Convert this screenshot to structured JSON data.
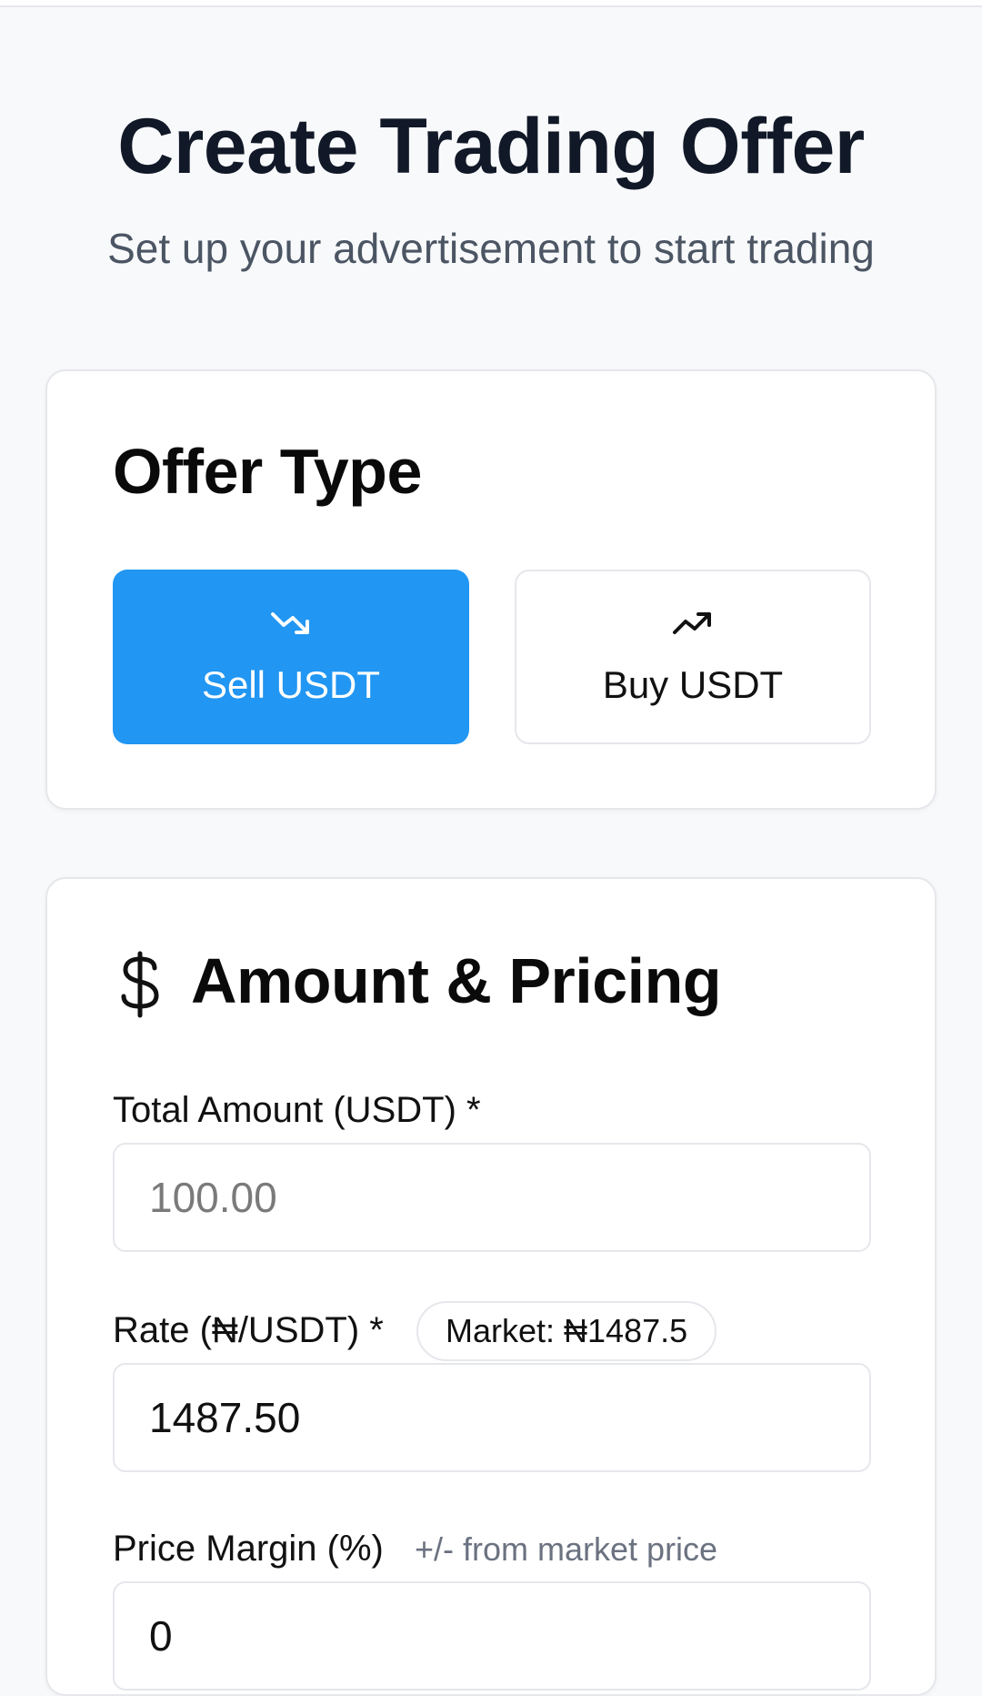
{
  "header": {
    "title": "Create Trading Offer",
    "subtitle": "Set up your advertisement to start trading"
  },
  "offer_type": {
    "title": "Offer Type",
    "sell": {
      "label": "Sell USDT",
      "icon": "trending-down-icon",
      "selected": true
    },
    "buy": {
      "label": "Buy USDT",
      "icon": "trending-up-icon",
      "selected": false
    }
  },
  "amount_pricing": {
    "title": "Amount & Pricing",
    "icon": "dollar-icon",
    "total_amount": {
      "label": "Total Amount (USDT) *",
      "placeholder": "100.00",
      "value": ""
    },
    "rate": {
      "label": "Rate (₦/USDT) *",
      "market_badge": "Market: ₦1487.5",
      "value": "1487.50"
    },
    "price_margin": {
      "label": "Price Margin (%)",
      "hint": "+/- from market price",
      "value": "0"
    }
  },
  "colors": {
    "accent": "#2196f3",
    "border": "#e5e7eb",
    "background": "#f8f9fb",
    "text_primary": "#111827",
    "text_secondary": "#4b5563"
  }
}
